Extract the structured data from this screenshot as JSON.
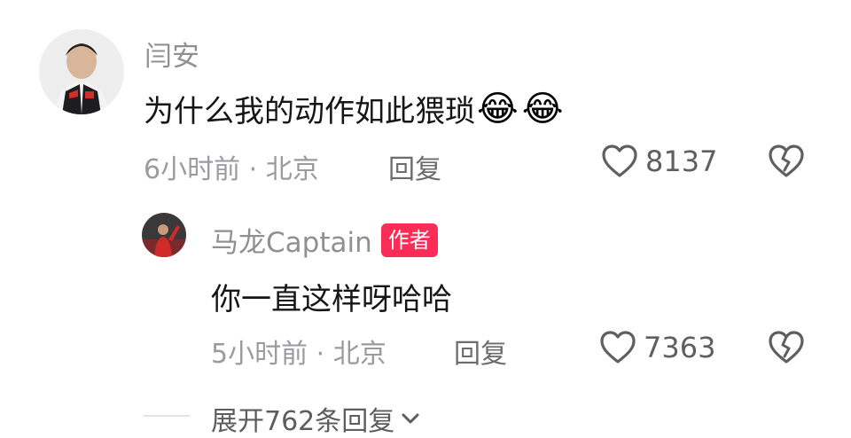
{
  "comment": {
    "username": "闫安",
    "text": "为什么我的动作如此猥琐",
    "emojis": [
      "😂",
      "😂"
    ],
    "time_location": "6小时前 · 北京",
    "reply_label": "回复",
    "likes": "8137"
  },
  "reply": {
    "username": "马龙Captain",
    "author_badge": "作者",
    "text": "你一直这样呀哈哈",
    "time_location": "5小时前 · 北京",
    "reply_label": "回复",
    "likes": "7363"
  },
  "expand": {
    "label": "展开762条回复"
  },
  "colors": {
    "badge": "#fb2c55",
    "meta": "#9a9aa0",
    "name": "#8f8f94"
  }
}
